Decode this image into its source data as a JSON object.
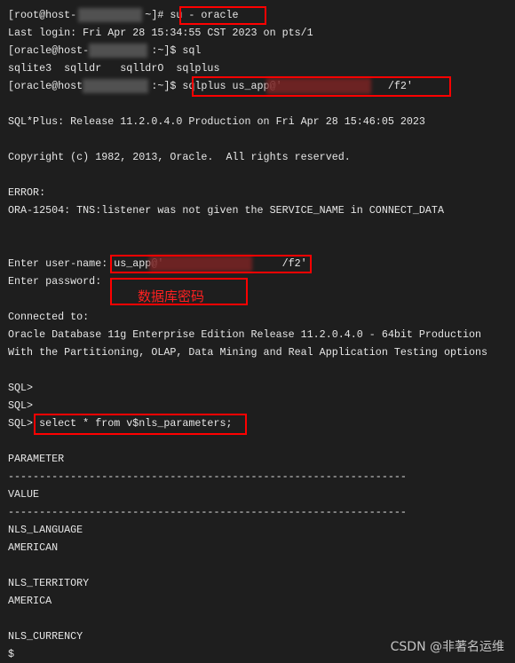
{
  "terminal": {
    "lines": [
      "[root@host-           ~]# su - oracle",
      "Last login: Fri Apr 28 15:34:55 CST 2023 on pts/1",
      "[oracle@host-          :~]$ sql",
      "sqlite3  sqlldr   sqlldrO  sqlplus",
      "[oracle@host           :~]$ sqlplus us_app@'                 /f2'",
      "",
      "SQL*Plus: Release 11.2.0.4.0 Production on Fri Apr 28 15:46:05 2023",
      "",
      "Copyright (c) 1982, 2013, Oracle.  All rights reserved.",
      "",
      "ERROR:",
      "ORA-12504: TNS:listener was not given the SERVICE_NAME in CONNECT_DATA",
      "",
      "",
      "Enter user-name: us_app@'                   /f2'",
      "Enter password:",
      "",
      "Connected to:",
      "Oracle Database 11g Enterprise Edition Release 11.2.0.4.0 - 64bit Production",
      "With the Partitioning, OLAP, Data Mining and Real Application Testing options",
      "",
      "SQL>",
      "SQL>",
      "SQL> select * from v$nls_parameters;",
      "",
      "PARAMETER",
      "----------------------------------------------------------------",
      "VALUE",
      "----------------------------------------------------------------",
      "NLS_LANGUAGE",
      "AMERICAN",
      "",
      "NLS_TERRITORY",
      "AMERICA",
      "",
      "NLS_CURRENCY",
      "$"
    ]
  },
  "annotation": {
    "password_note": "数据库密码",
    "highlight_color": "#ff0000"
  },
  "watermark": "CSDN @非著名运维"
}
